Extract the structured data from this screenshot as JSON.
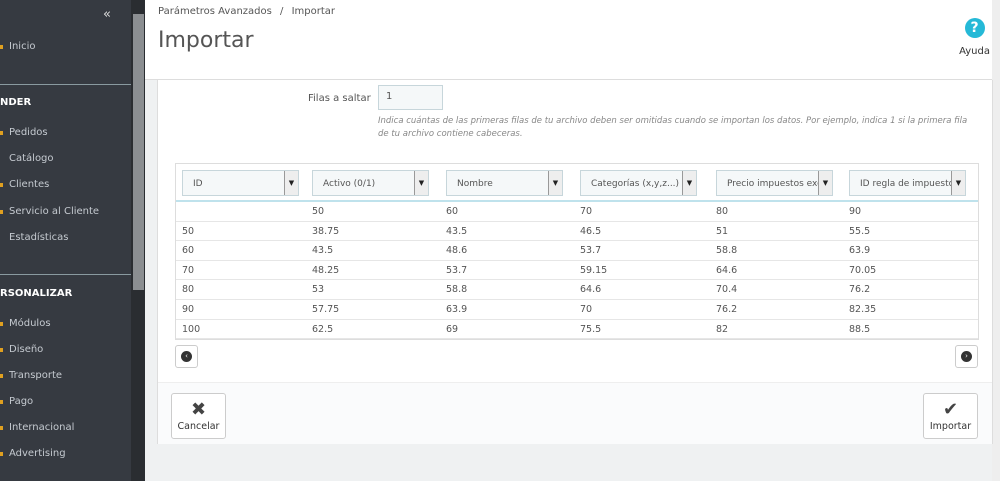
{
  "sidebar": {
    "items_top": [
      {
        "label": "Inicio"
      }
    ],
    "section1": "NDER",
    "items1": [
      "Pedidos",
      "Catálogo",
      "Clientes",
      "Servicio al Cliente",
      "Estadísticas"
    ],
    "section2": "RSONALIZAR",
    "items2": [
      "Módulos",
      "Diseño",
      "Transporte",
      "Pago",
      "Internacional",
      "Advertising"
    ]
  },
  "header": {
    "breadcrumb": [
      "Parámetros Avanzados",
      "/",
      "Importar"
    ],
    "title": "Importar",
    "help": "Ayuda"
  },
  "form": {
    "skip_label": "Filas a saltar",
    "skip_value": "1",
    "hint": "Indica cuántas de las primeras filas de tu archivo deben ser omitidas cuando se importan los datos. Por ejemplo, indica 1 si la primera fila de tu archivo contiene cabeceras."
  },
  "columns": [
    "ID",
    "Activo (0/1)",
    "Nombre",
    "Categorías (x,y,z...)",
    "Precio impuestos excluidos",
    "ID regla de impuestos"
  ],
  "rows": [
    [
      "",
      "50",
      "60",
      "70",
      "80",
      "90"
    ],
    [
      "50",
      "38.75",
      "43.5",
      "46.5",
      "51",
      "55.5"
    ],
    [
      "60",
      "43.5",
      "48.6",
      "53.7",
      "58.8",
      "63.9"
    ],
    [
      "70",
      "48.25",
      "53.7",
      "59.15",
      "64.6",
      "70.05"
    ],
    [
      "80",
      "53",
      "58.8",
      "64.6",
      "70.4",
      "76.2"
    ],
    [
      "90",
      "57.75",
      "63.9",
      "70",
      "76.2",
      "82.35"
    ],
    [
      "100",
      "62.5",
      "69",
      "75.5",
      "82",
      "88.5"
    ]
  ],
  "buttons": {
    "cancel": "Cancelar",
    "import": "Importar"
  }
}
